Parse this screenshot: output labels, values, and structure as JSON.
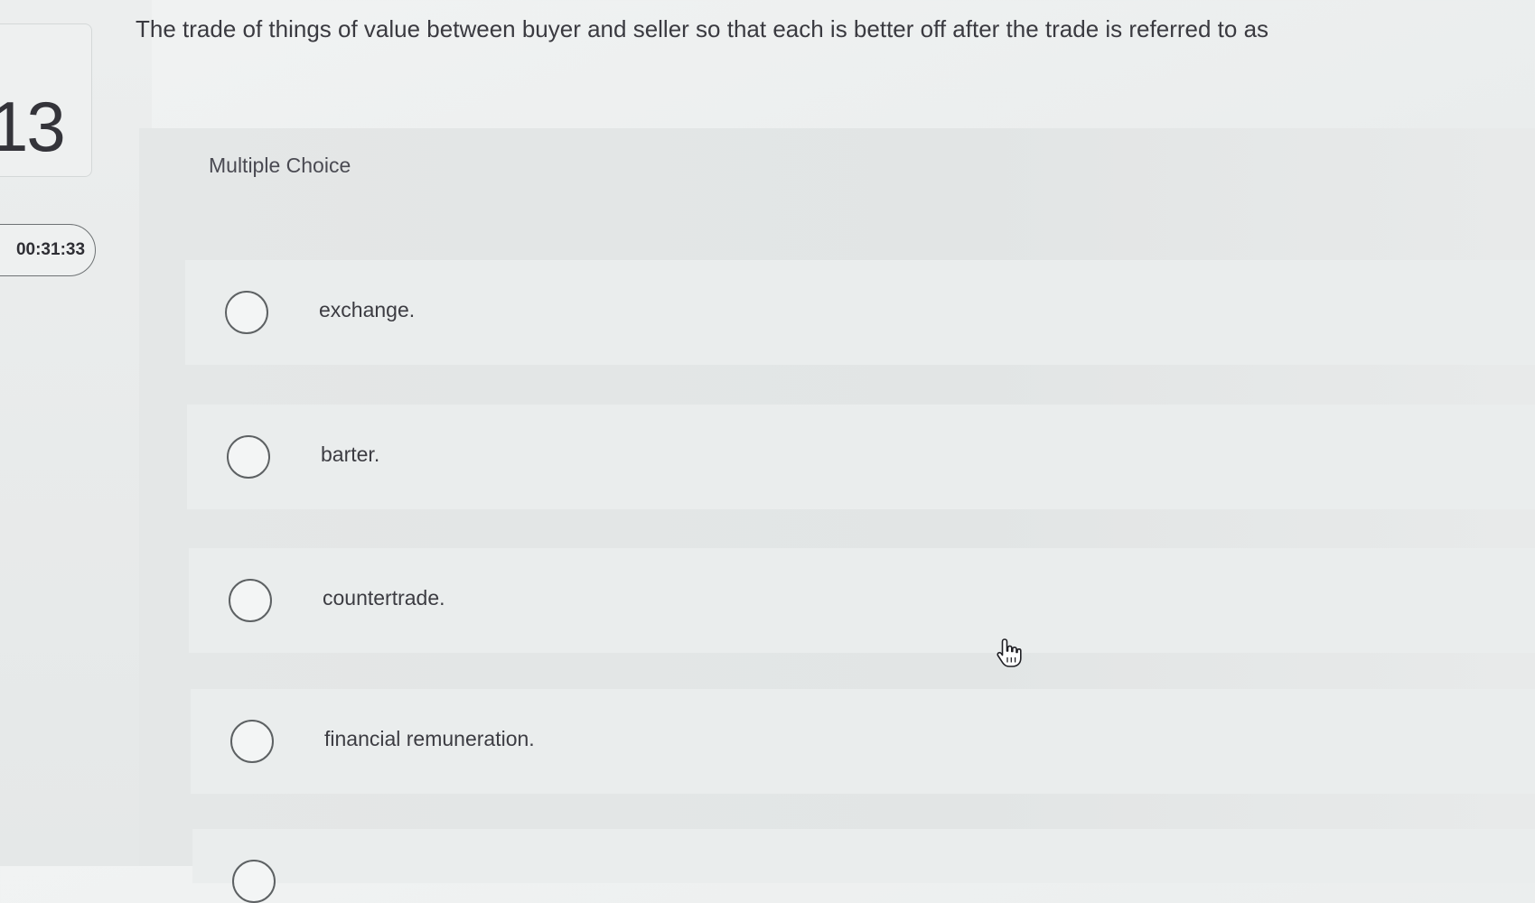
{
  "question": {
    "number": "13",
    "timer": "00:31:33",
    "text": "The trade of things of value between buyer and seller so that each is better off after the trade is referred to as"
  },
  "choice_section": {
    "heading": "Multiple Choice",
    "options": [
      {
        "label": "exchange."
      },
      {
        "label": "barter."
      },
      {
        "label": "countertrade."
      },
      {
        "label": "financial remuneration."
      }
    ]
  },
  "icons": {
    "radio": "radio-circle-icon",
    "cursor": "hand-pointer-icon"
  }
}
